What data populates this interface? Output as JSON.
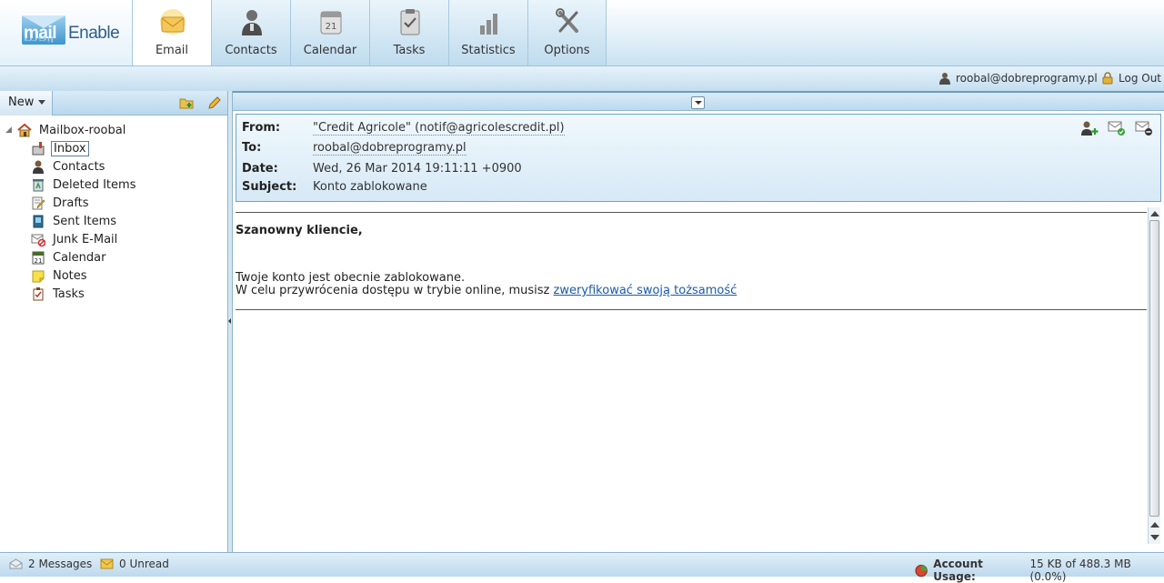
{
  "app": {
    "logo_mail": "mail",
    "logo_enable": "Enable"
  },
  "tabs": [
    {
      "label": "Email",
      "icon": "envelope-icon",
      "active": true
    },
    {
      "label": "Contacts",
      "icon": "person-icon"
    },
    {
      "label": "Calendar",
      "icon": "calendar-icon"
    },
    {
      "label": "Tasks",
      "icon": "clipboard-icon"
    },
    {
      "label": "Statistics",
      "icon": "bar-chart-icon"
    },
    {
      "label": "Options",
      "icon": "tools-icon"
    }
  ],
  "userbar": {
    "user": "roobal@dobreprogramy.pl",
    "logout": "Log Out"
  },
  "left": {
    "new_label": "New",
    "tree": [
      {
        "label": "Mailbox-roobal",
        "icon": "mailbox-home-icon",
        "level": 0
      },
      {
        "label": "Inbox",
        "icon": "inbox-icon",
        "level": 1,
        "selected": true
      },
      {
        "label": "Contacts",
        "icon": "contact-icon",
        "level": 1
      },
      {
        "label": "Deleted Items",
        "icon": "trash-icon",
        "level": 1
      },
      {
        "label": "Drafts",
        "icon": "drafts-icon",
        "level": 1
      },
      {
        "label": "Sent Items",
        "icon": "sent-icon",
        "level": 1
      },
      {
        "label": "Junk E-Mail",
        "icon": "junk-icon",
        "level": 1
      },
      {
        "label": "Calendar",
        "icon": "calendar-small-icon",
        "level": 1
      },
      {
        "label": "Notes",
        "icon": "note-icon",
        "level": 1
      },
      {
        "label": "Tasks",
        "icon": "task-icon",
        "level": 1
      }
    ]
  },
  "message": {
    "from_label": "From:",
    "from": "\"Credit Agricole\" (notif@agricolescredit.pl)",
    "to_label": "To:",
    "to": "roobal@dobreprogramy.pl",
    "date_label": "Date:",
    "date": "Wed, 26 Mar 2014 19:11:11 +0900",
    "subject_label": "Subject:",
    "subject": "Konto zablokowane",
    "greeting": "Szanowny kliencie,",
    "line1": "Twoje konto jest obecnie zablokowane.",
    "line2_prefix": "W celu przywrócenia dostępu w trybie online, musisz ",
    "line2_link": "zweryfikować swoją tożsamość"
  },
  "status": {
    "messages": "2 Messages",
    "unread": "0 Unread",
    "usage_label": "Account Usage:",
    "usage_value": "15 KB of 488.3 MB (0.0%)"
  }
}
